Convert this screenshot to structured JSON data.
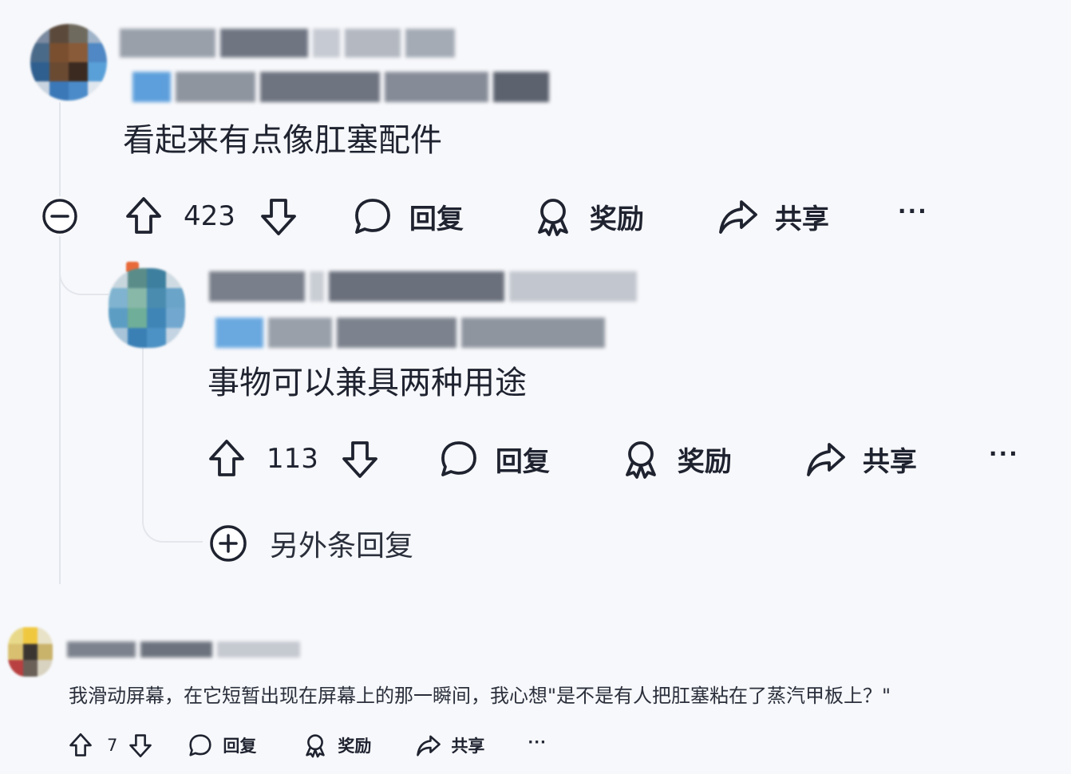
{
  "comment1": {
    "text": "看起来有点像肛塞配件",
    "upvotes": "423",
    "reply_label": "回复",
    "award_label": "奖励",
    "share_label": "共享",
    "more_label": "···"
  },
  "comment2": {
    "text": "事物可以兼具两种用途",
    "upvotes": "113",
    "reply_label": "回复",
    "award_label": "奖励",
    "share_label": "共享",
    "more_label": "···"
  },
  "more_replies": {
    "label": "另外条回复"
  },
  "comment3": {
    "text": "我滑动屏幕，在它短暂出现在屏幕上的那一瞬间，我心想\"是不是有人把肛塞粘在了蒸汽甲板上？\"",
    "upvotes": "7",
    "reply_label": "回复",
    "award_label": "奖励",
    "share_label": "共享",
    "more_label": "···"
  },
  "icons": {
    "upvote": "arrow-up-icon",
    "downvote": "arrow-down-icon",
    "reply": "speech-bubble-icon",
    "award": "award-ribbon-icon",
    "share": "share-arrow-icon",
    "collapse": "minus-circle-icon",
    "expand": "plus-circle-icon"
  },
  "colors": {
    "background": "#f7f8fb",
    "text": "#1f2330",
    "thread_line": "#e3e6ec"
  }
}
